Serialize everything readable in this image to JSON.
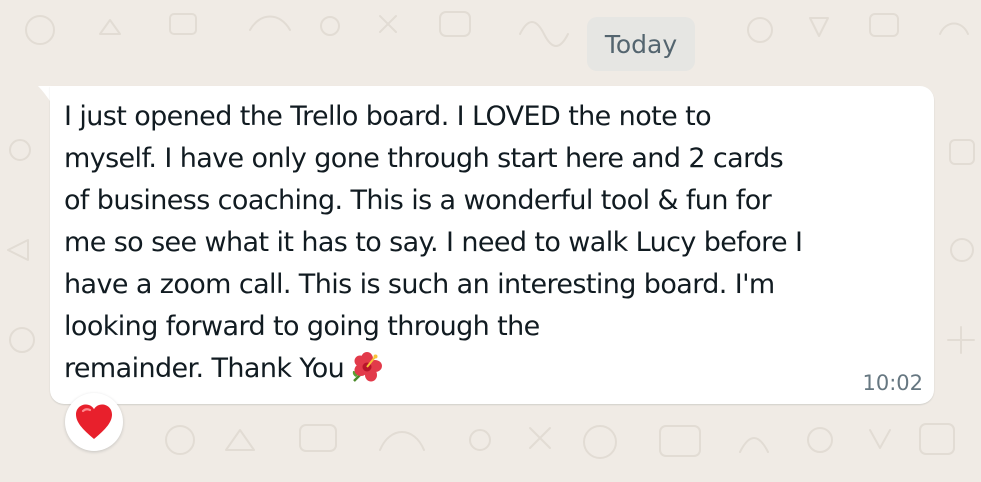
{
  "date_separator": "Today",
  "message": {
    "lines": [
      "I just opened the Trello board. I LOVED the note to",
      "myself. I have only gone through start here and 2 cards",
      "of business coaching. This is a wonderful tool & fun for",
      "me so see what it has to say. I need to walk Lucy before I",
      "have a zoom call.  This is such an interesting board. I'm",
      "looking forward to going through the",
      "remainder. Thank You"
    ],
    "emoji": "hibiscus-emoji",
    "time": "10:02"
  },
  "reaction": {
    "emoji": "red-heart-emoji"
  },
  "colors": {
    "background": "#f0ebe5",
    "bubble": "#ffffff",
    "text": "#111b21",
    "meta_text": "#667781",
    "date_pill": "#e6e6e3",
    "heart": "#e8202c"
  }
}
